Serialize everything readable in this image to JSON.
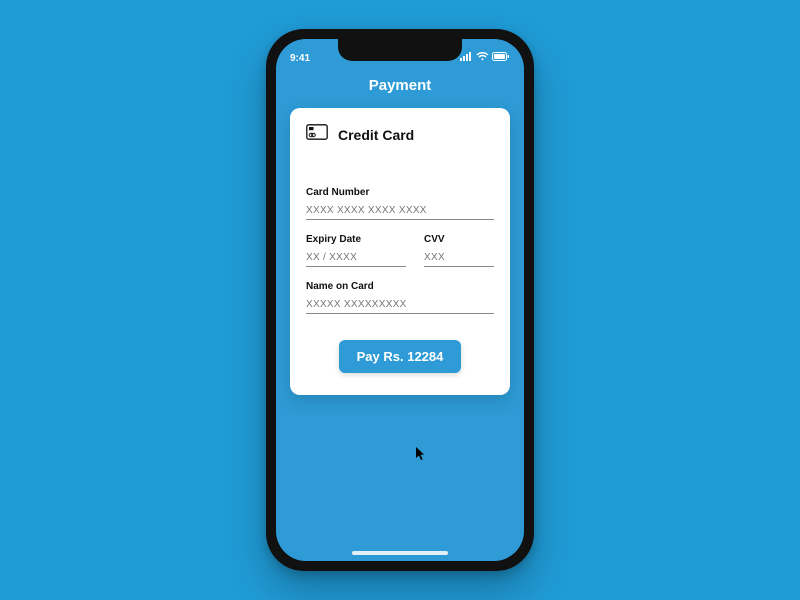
{
  "status": {
    "time": "9:41"
  },
  "header": {
    "title": "Payment"
  },
  "card": {
    "title": "Credit Card",
    "fields": {
      "card_number": {
        "label": "Card Number",
        "placeholder": "XXXX XXXX XXXX XXXX"
      },
      "expiry": {
        "label": "Expiry Date",
        "placeholder": "XX / XXXX"
      },
      "cvv": {
        "label": "CVV",
        "placeholder": "XXX"
      },
      "name": {
        "label": "Name on Card",
        "placeholder": "XXXXX XXXXXXXXX"
      }
    }
  },
  "button": {
    "label": "Pay Rs. 12284"
  },
  "colors": {
    "accent": "#2e9bd6",
    "background": "#209bd6"
  }
}
